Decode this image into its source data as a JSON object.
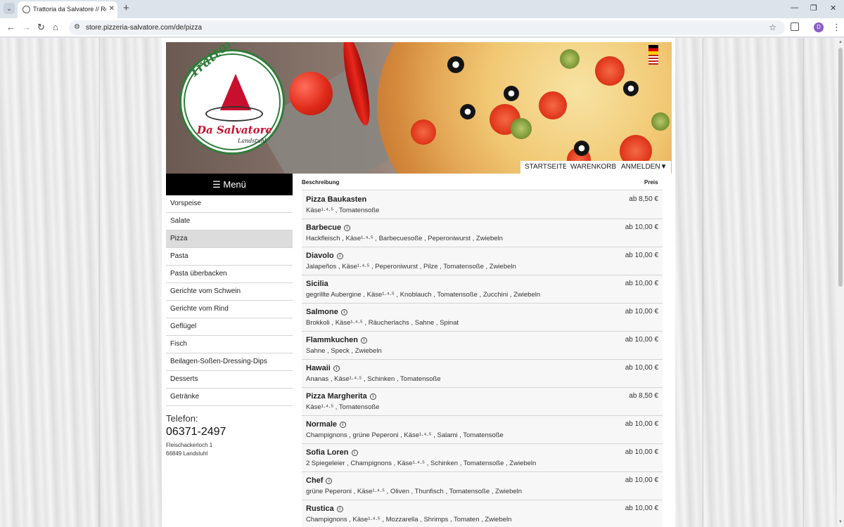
{
  "browser": {
    "tab_title": "Trattoria da Salvatore // Restaurant",
    "tab_close": "✕",
    "new_tab": "+",
    "url": "store.pizzeria-salvatore.com/de/pizza",
    "win_min": "—",
    "win_max": "❐",
    "win_close": "✕",
    "avatar_letter": "D"
  },
  "logo": {
    "line1": "Trattoria",
    "line2": "Da Salvatore",
    "line3": "Landstuhl"
  },
  "topnav": {
    "home": "STARTSEITE",
    "cart": "WARENKORB",
    "login": "ANMELDEN▼"
  },
  "sidebar": {
    "menu_title": "☰ Menü",
    "categories": [
      {
        "label": "Vorspeise",
        "active": false
      },
      {
        "label": "Salate",
        "active": false
      },
      {
        "label": "Pizza",
        "active": true
      },
      {
        "label": "Pasta",
        "active": false
      },
      {
        "label": "Pasta überbacken",
        "active": false
      },
      {
        "label": "Gerichte vom Schwein",
        "active": false
      },
      {
        "label": "Gerichte vom Rind",
        "active": false
      },
      {
        "label": "Geflügel",
        "active": false
      },
      {
        "label": "Fisch",
        "active": false
      },
      {
        "label": "Beilagen-Soßen-Dressing-Dips",
        "active": false
      },
      {
        "label": "Desserts",
        "active": false
      },
      {
        "label": "Getränke",
        "active": false
      }
    ],
    "phone_label": "Telefon:",
    "phone_number": "06371-2497",
    "address_line1": "Fleischackerloch 1",
    "address_line2": "66849 Landstuhl"
  },
  "list": {
    "col_description": "Beschreibung",
    "col_price": "Preis",
    "items": [
      {
        "name": "Pizza Baukasten",
        "desc": "Käse¹·⁴·⁵ , Tomatensoße",
        "price": "ab 8,50 €"
      },
      {
        "name": "Barbecue",
        "desc": "Hackfleisch , Käse¹·⁴·⁵ , Barbecuesoße , Peperoniwurst , Zwiebeln",
        "price": "ab 10,00 €"
      },
      {
        "name": "Diavolo",
        "desc": "Jalapeños , Käse¹·⁴·⁵ , Peperoniwurst , Pilze , Tomatensoße , Zwiebeln",
        "price": "ab 10,00 €"
      },
      {
        "name": "Sicilia",
        "desc": "gegrillte Aubergine , Käse¹·⁴·⁵ , Knoblauch , Tomatensoße , Zucchini , Zwiebeln",
        "price": "ab 10,00 €"
      },
      {
        "name": "Salmone",
        "desc": "Brokkoli , Käse¹·⁴·⁵ , Räucherlachs , Sahne , Spinat",
        "price": "ab 10,00 €"
      },
      {
        "name": "Flammkuchen",
        "desc": "Sahne , Speck , Zwiebeln",
        "price": "ab 10,00 €"
      },
      {
        "name": "Hawaii",
        "desc": "Ananas , Käse¹·⁴·⁵ , Schinken , Tomatensoße",
        "price": "ab 10,00 €"
      },
      {
        "name": "Pizza Margherita",
        "desc": "Käse¹·⁴·⁵ , Tomatensoße",
        "price": "ab 8,50 €"
      },
      {
        "name": "Normale",
        "desc": "Champignons , grüne Peperoni , Käse¹·⁴·⁵ , Salami , Tomatensoße",
        "price": "ab 10,00 €"
      },
      {
        "name": "Sofia Loren",
        "desc": "2 Spiegeleier , Champignons , Käse¹·⁴·⁵ , Schinken , Tomatensoße , Zwiebeln",
        "price": "ab 10,00 €"
      },
      {
        "name": "Chef",
        "desc": "grüne Peperoni , Käse¹·⁴·⁵ , Oliven , Thunfisch , Tomatensoße , Zwiebeln",
        "price": "ab 10,00 €"
      },
      {
        "name": "Rustica",
        "desc": "Champignons , Käse¹·⁴·⁵ , Mozzarella , Shrimps , Tomaten , Zwiebeln",
        "price": "ab 10,00 €"
      }
    ]
  }
}
